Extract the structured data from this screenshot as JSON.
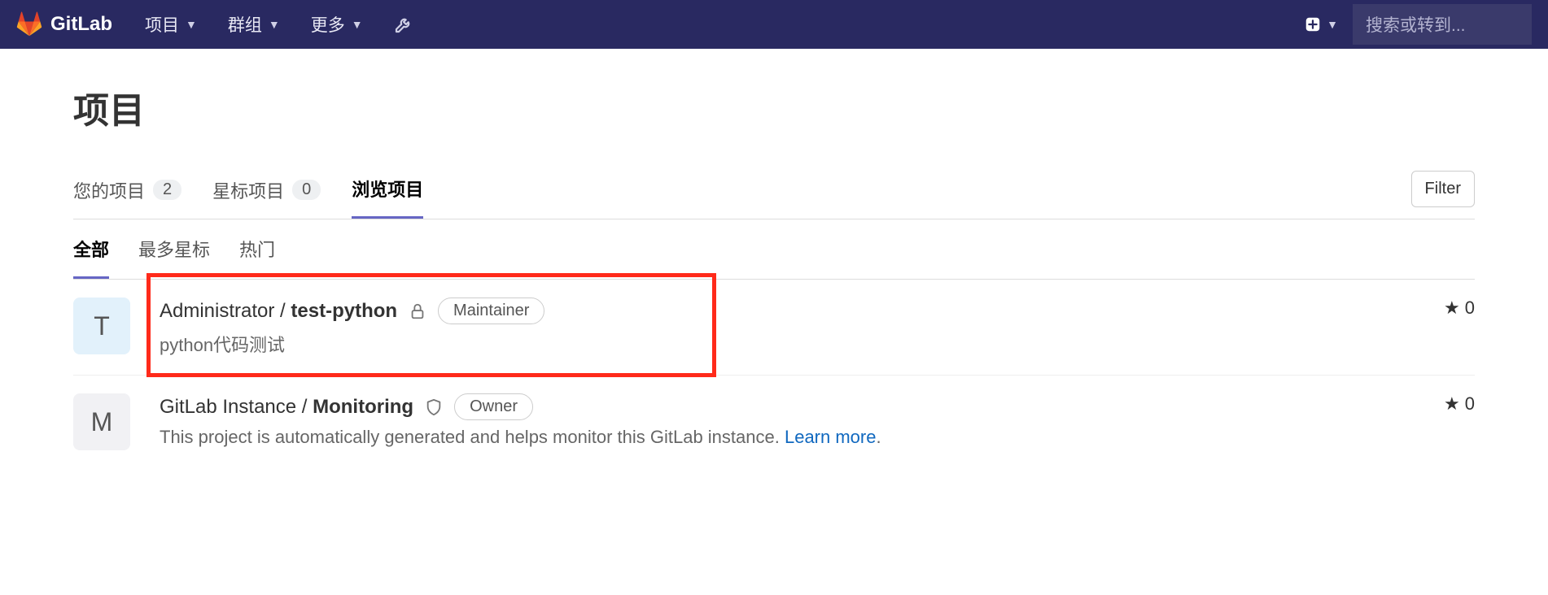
{
  "navbar": {
    "brand": "GitLab",
    "projects": "项目",
    "groups": "群组",
    "more": "更多",
    "search_placeholder": "搜索或转到..."
  },
  "page": {
    "title": "项目",
    "filter": "Filter"
  },
  "tabs": {
    "your": {
      "label": "您的项目",
      "count": "2"
    },
    "starred": {
      "label": "星标项目",
      "count": "0"
    },
    "explore": {
      "label": "浏览项目"
    }
  },
  "subtabs": {
    "all": "全部",
    "most_stars": "最多星标",
    "trending": "热门"
  },
  "projects": [
    {
      "avatar_letter": "T",
      "avatar_class": "blue",
      "namespace": "Administrator / ",
      "name": "test-python",
      "role": "Maintainer",
      "visibility": "private",
      "description": "python代码测试",
      "stars": "0",
      "highlighted": true
    },
    {
      "avatar_letter": "M",
      "avatar_class": "grey",
      "namespace": "GitLab Instance / ",
      "name": "Monitoring",
      "role": "Owner",
      "visibility": "internal",
      "description": "This project is automatically generated and helps monitor this GitLab instance. ",
      "learn_more": "Learn more",
      "stars": "0",
      "highlighted": false
    }
  ]
}
